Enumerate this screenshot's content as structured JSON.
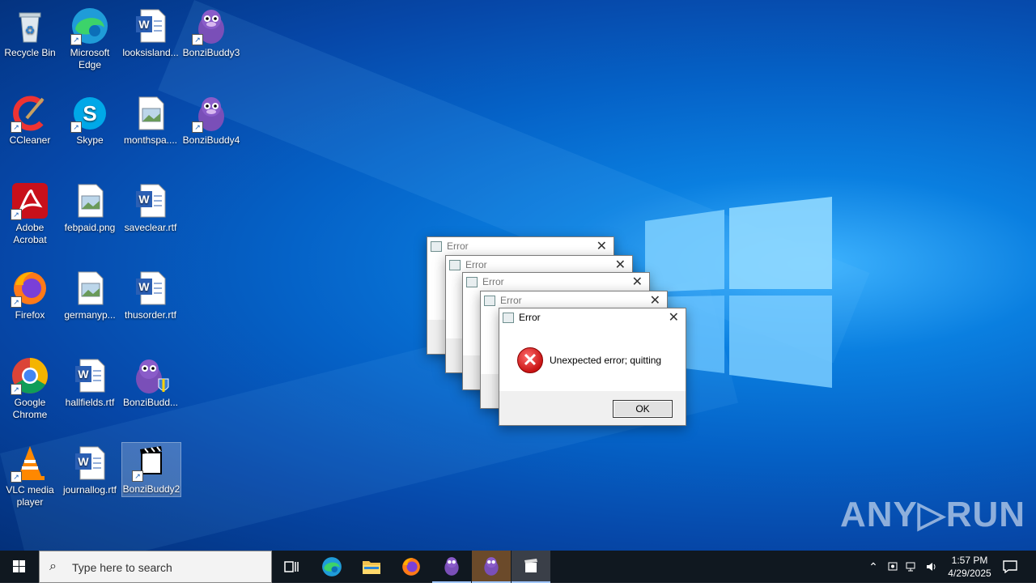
{
  "desktop": {
    "icons": [
      {
        "label": "Recycle Bin",
        "icon": "recycle-bin-icon"
      },
      {
        "label": "Microsoft Edge",
        "icon": "edge-icon"
      },
      {
        "label": "looksisland...",
        "icon": "word-doc-icon"
      },
      {
        "label": "BonziBuddy3",
        "icon": "bonzi-icon"
      },
      {
        "label": "CCleaner",
        "icon": "ccleaner-icon"
      },
      {
        "label": "Skype",
        "icon": "skype-icon"
      },
      {
        "label": "monthspa....",
        "icon": "image-file-icon"
      },
      {
        "label": "BonziBuddy4",
        "icon": "bonzi-icon"
      },
      {
        "label": "Adobe Acrobat",
        "icon": "acrobat-icon"
      },
      {
        "label": "febpaid.png",
        "icon": "image-file-icon"
      },
      {
        "label": "saveclear.rtf",
        "icon": "word-doc-icon"
      },
      {
        "label": "Firefox",
        "icon": "firefox-icon"
      },
      {
        "label": "germanyp...",
        "icon": "image-file-icon"
      },
      {
        "label": "thusorder.rtf",
        "icon": "word-doc-icon"
      },
      {
        "label": "Google Chrome",
        "icon": "chrome-icon"
      },
      {
        "label": "hallfields.rtf",
        "icon": "word-doc-icon"
      },
      {
        "label": "BonziBudd...",
        "icon": "bonzi-shield-icon"
      },
      {
        "label": "VLC media player",
        "icon": "vlc-icon"
      },
      {
        "label": "journallog.rtf",
        "icon": "word-doc-icon"
      },
      {
        "label": "BonziBuddy2",
        "icon": "clapper-file-icon"
      }
    ]
  },
  "dialogs": {
    "title": "Error",
    "message": "Unexpected error; quitting",
    "ok_label": "OK",
    "close_glyph": "✕"
  },
  "taskbar": {
    "search_placeholder": "Type here to search",
    "time": "1:57 PM",
    "date": "4/29/2025"
  },
  "watermark": "ANY▷RUN",
  "colors": {
    "error_red": "#c81414",
    "desktop_blue": "#0563c8",
    "taskbar": "#101820"
  }
}
